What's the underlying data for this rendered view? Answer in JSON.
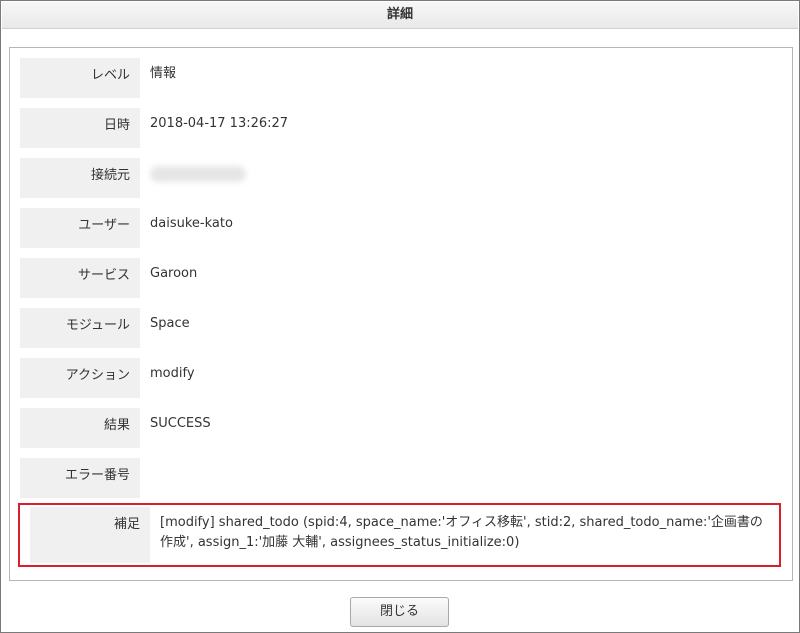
{
  "dialog": {
    "title": "詳細"
  },
  "detail": {
    "rows": [
      {
        "label": "レベル",
        "value": "情報"
      },
      {
        "label": "日時",
        "value": "2018-04-17 13:26:27"
      },
      {
        "label": "接続元",
        "value": ""
      },
      {
        "label": "ユーザー",
        "value": "daisuke-kato"
      },
      {
        "label": "サービス",
        "value": "Garoon"
      },
      {
        "label": "モジュール",
        "value": "Space"
      },
      {
        "label": "アクション",
        "value": "modify"
      },
      {
        "label": "結果",
        "value": "SUCCESS"
      },
      {
        "label": "エラー番号",
        "value": ""
      }
    ],
    "note": {
      "label": "補足",
      "value": "[modify] shared_todo (spid:4, space_name:'オフィス移転', stid:2, shared_todo_name:'企画書の作成', assign_1:'加藤 大輔', assignees_status_initialize:0)"
    }
  },
  "footer": {
    "close_label": "閉じる"
  },
  "colors": {
    "highlight_border": "#d9202a",
    "label_bg": "#f0f0f0"
  }
}
